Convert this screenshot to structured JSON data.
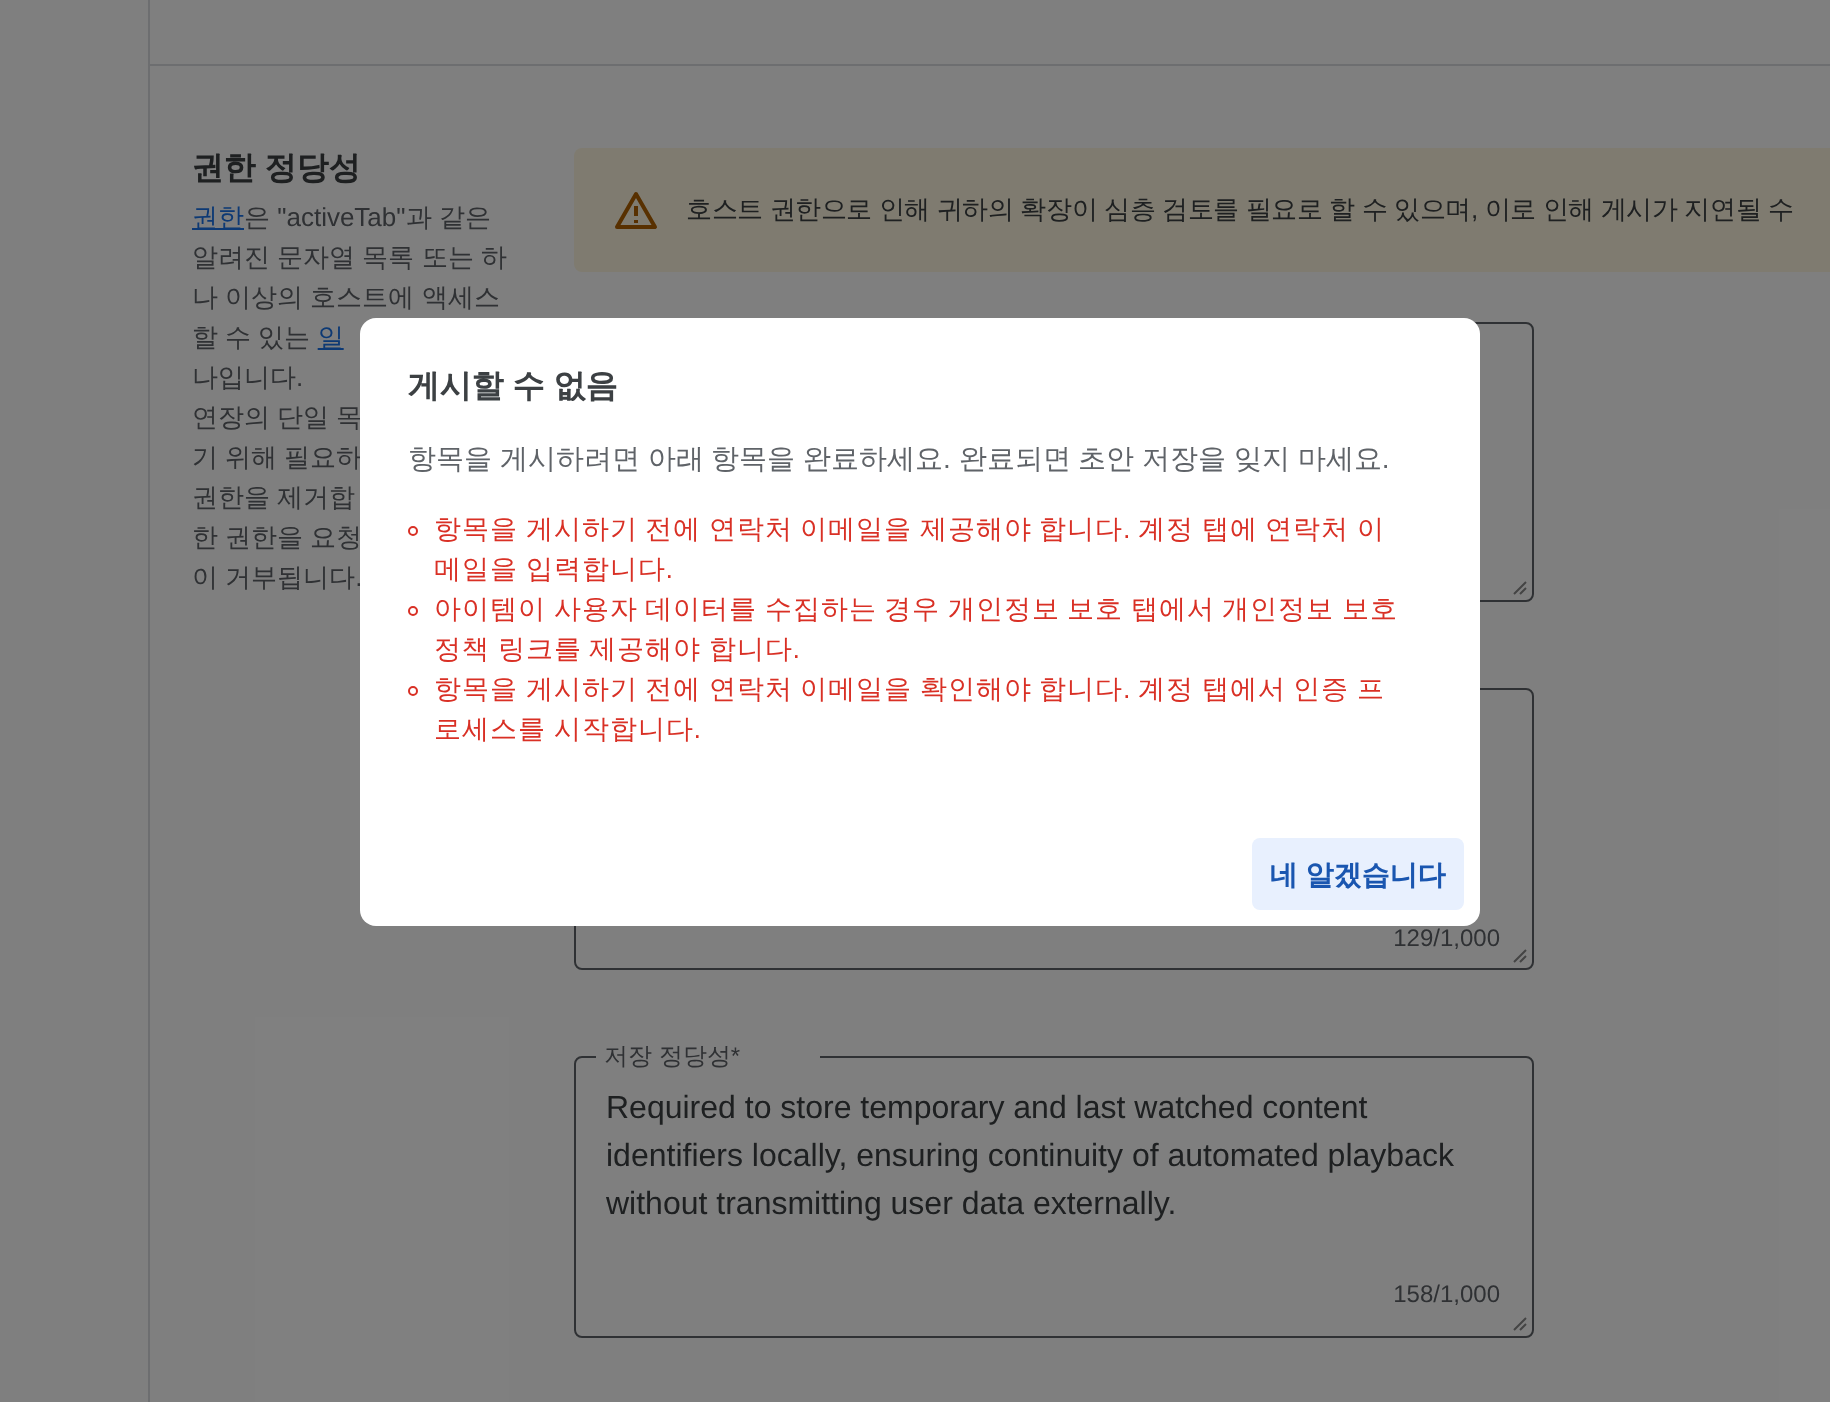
{
  "section": {
    "title": "권한 정당성",
    "lines": [
      [
        {
          "text": "권한",
          "link": true
        },
        {
          "text": "은 \"activeTab\"과 같은",
          "link": false
        }
      ],
      [
        {
          "text": "알려진 문자열 목록 또는 하",
          "link": false
        }
      ],
      [
        {
          "text": "나 이상의 호스트에 액세스",
          "link": false
        }
      ],
      [
        {
          "text": "할 수 있는 ",
          "link": false
        },
        {
          "text": "일",
          "link": true
        }
      ],
      [
        {
          "text": "나입니다.",
          "link": false
        }
      ],
      [
        {
          "text": "연장의 단일 목",
          "link": false
        }
      ],
      [
        {
          "text": "기 위해 필요하",
          "link": false
        }
      ],
      [
        {
          "text": "권한을 제거합",
          "link": false
        }
      ],
      [
        {
          "text": "한 권한을 요청",
          "link": false
        }
      ],
      [
        {
          "text": "이 거부됩니다.",
          "link": false
        }
      ]
    ]
  },
  "banner": {
    "text": "호스트 권한으로 인해 귀하의 확장이 심층 검토를 필요로 할 수 있으며, 이로 인해 게시가 지연될 수"
  },
  "fields": [
    {
      "kind": "covered"
    },
    {
      "kind": "partial",
      "counter": "129/1,000"
    },
    {
      "kind": "full",
      "label": "저장 정당성*",
      "value": "Required to store temporary and last watched content identifiers locally, ensuring continuity of automated playback without transmitting user data externally.",
      "counter": "158/1,000"
    }
  ],
  "dialog": {
    "title": "게시할 수 없음",
    "message": "항목을 게시하려면 아래 항목을 완료하세요. 완료되면 초안 저장을 잊지 마세요.",
    "errors": [
      "항목을 게시하기 전에 연락처 이메일을 제공해야 합니다. 계정 탭에 연락처 이메일을 입력합니다.",
      "아이템이 사용자 데이터를 수집하는 경우 개인정보 보호 탭에서 개인정보 보호정책 링크를 제공해야 합니다.",
      "항목을 게시하기 전에 연락처 이메일을 확인해야 합니다. 계정 탭에서 인증 프로세스를 시작합니다."
    ],
    "button": "네 알겠습니다"
  }
}
